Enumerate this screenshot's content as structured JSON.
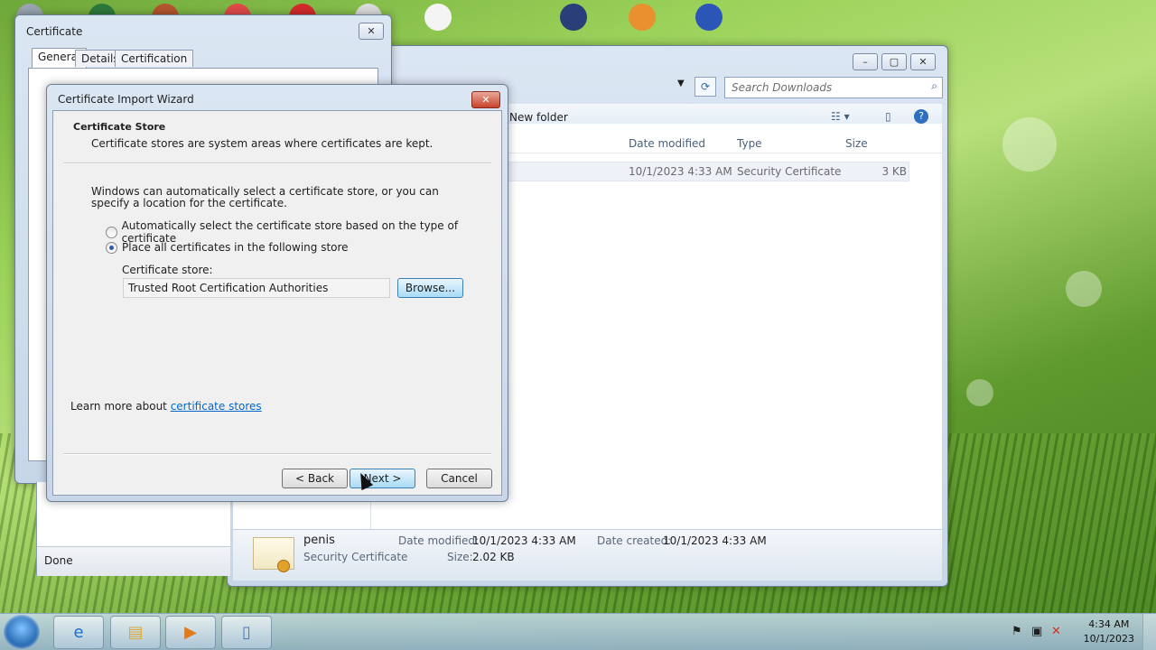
{
  "certificate_dialog": {
    "title": "Certificate",
    "close_symbol": "✕",
    "tabs": [
      "General",
      "Details",
      "Certification Path"
    ]
  },
  "explorer": {
    "search_placeholder": "Search Downloads",
    "toolbar": {
      "new_folder": "New folder"
    },
    "columns": [
      "Date modified",
      "Type",
      "Size"
    ],
    "file": {
      "date_modified": "10/1/2023 4:33 AM",
      "type": "Security Certificate",
      "size": "3 KB"
    },
    "status": "Done",
    "details": {
      "name": "penis",
      "type": "Security Certificate",
      "date_modified_label": "Date modified:",
      "date_modified": "10/1/2023 4:33 AM",
      "date_created_label": "Date created:",
      "date_created": "10/1/2023 4:33 AM",
      "size_label": "Size:",
      "size": "2.02 KB"
    }
  },
  "wizard": {
    "title": "Certificate Import Wizard",
    "close_symbol": "✕",
    "header_title": "Certificate Store",
    "header_subtitle": "Certificate stores are system areas where certificates are kept.",
    "description": "Windows can automatically select a certificate store, or you can specify a location for the certificate.",
    "options": [
      {
        "label": "Automatically select the certificate store based on the type of certificate",
        "checked": false
      },
      {
        "label": "Place all certificates in the following store",
        "checked": true
      }
    ],
    "store_label": "Certificate store:",
    "store_value": "Trusted Root Certification Authorities",
    "browse_label": "Browse...",
    "learn_prefix": "Learn more about ",
    "learn_link": "certificate stores",
    "back_label": "< Back",
    "next_label": "Next >",
    "cancel_label": "Cancel"
  },
  "taskbar": {
    "time": "4:34 AM",
    "date": "10/1/2023"
  },
  "icons": [
    "windows-start-icon",
    "internet-explorer-icon",
    "folder-icon",
    "media-player-icon",
    "document-icon",
    "flag-icon",
    "network-icon",
    "volume-muted-icon"
  ],
  "colors": {
    "accent": "#3c7fb1",
    "link": "#0066cc"
  }
}
